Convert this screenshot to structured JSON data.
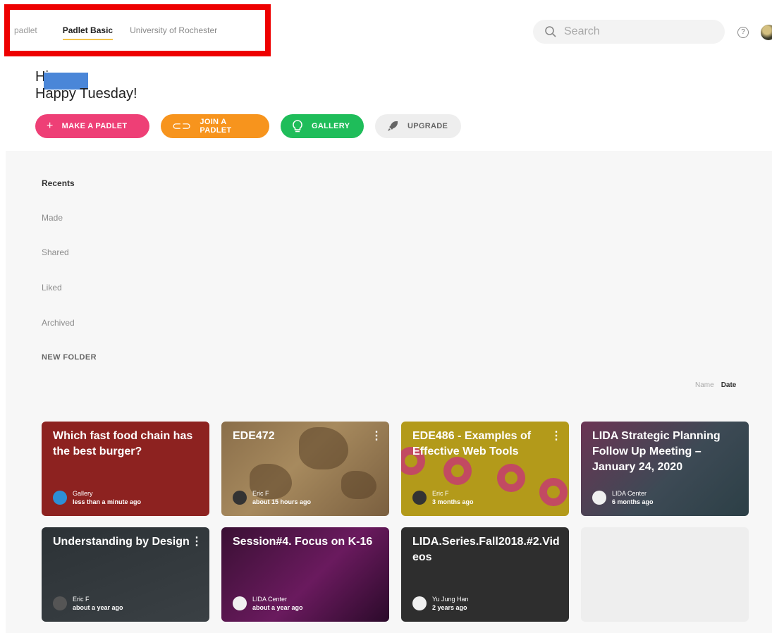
{
  "nav": {
    "brand": "padlet",
    "tabs": [
      {
        "label": "Padlet Basic",
        "active": true
      },
      {
        "label": "University of Rochester",
        "active": false
      }
    ]
  },
  "search": {
    "placeholder": "Search"
  },
  "header_icons": {
    "help": "question-circle-icon",
    "account": "user-avatar"
  },
  "greeting": {
    "line1": "Hi",
    "line2": "Happy Tuesday!"
  },
  "actions": [
    {
      "label": "MAKE A PADLET",
      "icon": "plus-icon"
    },
    {
      "label": "JOIN A PADLET",
      "icon": "link-icon"
    },
    {
      "label": "GALLERY",
      "icon": "lightbulb-icon"
    },
    {
      "label": "UPGRADE",
      "icon": "rocket-icon"
    }
  ],
  "sidebar": {
    "items": [
      "Recents",
      "Made",
      "Shared",
      "Liked",
      "Archived",
      "NEW FOLDER"
    ]
  },
  "sort": {
    "name": "Name",
    "date": "Date",
    "active": "Date"
  },
  "cards": [
    {
      "title": "Which fast food chain has the best burger?",
      "author": "Gallery",
      "time": "less than a minute ago"
    },
    {
      "title": "EDE472",
      "author": "Eric F",
      "time": "about 15 hours ago"
    },
    {
      "title": "EDE486 - Examples of Effective Web Tools",
      "author": "Eric F",
      "time": "3 months ago"
    },
    {
      "title": "LIDA Strategic Planning Follow Up Meeting – January 24, 2020",
      "author": "LIDA Center",
      "time": "6 months ago"
    },
    {
      "title": "Understanding by Design",
      "author": "Eric F",
      "time": "about a year ago"
    },
    {
      "title": "Session#4. Focus on K-16",
      "author": "LIDA Center",
      "time": "about a year ago"
    },
    {
      "title": "LIDA.Series.Fall2018.#2.Videos",
      "author": "Yu Jung Han",
      "time": "2 years ago"
    }
  ],
  "colors": {
    "pink": "#ee3f76",
    "orange": "#f7941d",
    "green": "#1fbd5a",
    "annotation": "#ee0000"
  }
}
